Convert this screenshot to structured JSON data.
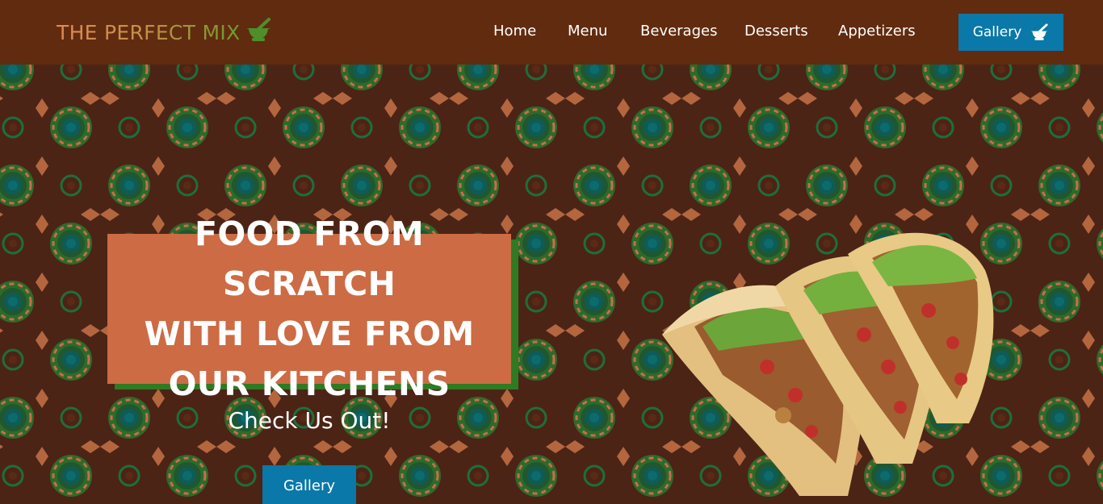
{
  "brand": {
    "name": "THE PERFECT MIX",
    "icon": "mortar-pestle-icon"
  },
  "nav": {
    "items": [
      {
        "label": "Home"
      },
      {
        "label": "Menu"
      },
      {
        "label": "Beverages"
      },
      {
        "label": "Desserts"
      },
      {
        "label": "Appetizers"
      }
    ],
    "gallery_button": {
      "label": "Gallery",
      "icon": "mortar-pestle-icon"
    }
  },
  "hero": {
    "headline": "FOOD FROM SCRATCH\nWITH LOVE FROM\nOUR KITCHENS",
    "subheadline": "Check Us Out!",
    "cta_label": "Gallery",
    "image": "tacos-image"
  },
  "colors": {
    "navbar": "#612b0f",
    "hero_background": "#4b2416",
    "headline_box": "#cc6b44",
    "headline_shadow": "#2f7a23",
    "button": "#0a78a8"
  }
}
